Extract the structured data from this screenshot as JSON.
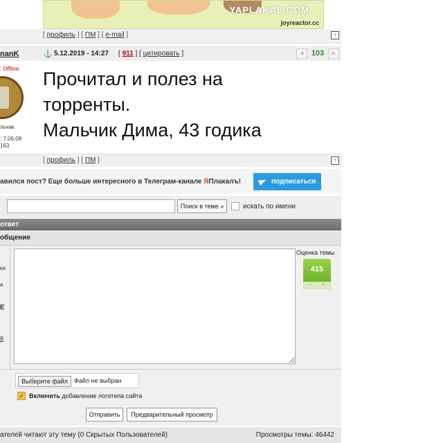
{
  "image": {
    "watermark": "YAPLAKAL.COM",
    "source": "joyreactor.cc"
  },
  "links": {
    "profile": "профиль",
    "pm": "ПМ",
    "email": "e-mail"
  },
  "post": {
    "username": "nanK",
    "status": "Offline",
    "date": "5.12.2019 - 14:27",
    "number": "911",
    "quote": "цитировать",
    "score": "103",
    "side_name": "льчак",
    "side_date": "7.06.08",
    "side_count": "163",
    "text_line1": "Прочитал и полез на",
    "text_line2": "торренты.",
    "text_line3": "Мальчик Дима, 43 годика"
  },
  "telegram": {
    "text_before": "авился пост? Еще больше интересного в Телеграм-канале ",
    "channel_red": "Я",
    "channel_rest": "Плакалъ!",
    "button": "подписаться"
  },
  "search": {
    "value": "",
    "button": "Поиск в теме »",
    "checkbox_label": "искать по имени"
  },
  "reply": {
    "header": "ответ",
    "subheader": "общение"
  },
  "left_frags": [
    "ки",
    "е",
    "Е",
    "В"
  ],
  "rating": {
    "label": "Оценка темы",
    "value": "415",
    "minus": "−",
    "plus": "+"
  },
  "file": {
    "button": "Выберите файл",
    "status": "Файл не выбран"
  },
  "logo": {
    "bold": "Включить",
    "rest": " добавление логотипа сайта"
  },
  "buttons": {
    "submit": "Отправить",
    "preview": "Предварительный просмотр"
  },
  "footer": {
    "readers": "ателей читают эту тему (0 Скрытых Пользователей)",
    "views": "Просмотры темы: 46442"
  },
  "colors": {
    "telegram": "#2b9ce0",
    "score": "#2b8a2b",
    "rating": "#7dbd34",
    "header": "#7a7a7a"
  }
}
